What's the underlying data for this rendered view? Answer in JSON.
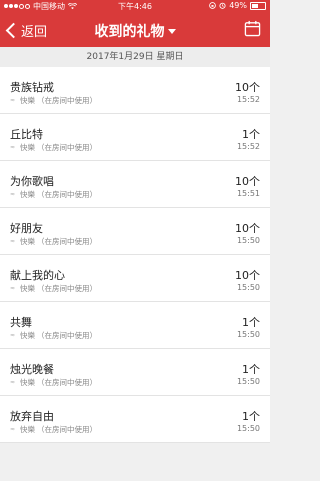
{
  "statusbar": {
    "carrier": "中国移动",
    "time": "下午4:46",
    "battery": "49%",
    "battery_level": 0.49
  },
  "nav": {
    "back_label": "返回",
    "title": "收到的礼物"
  },
  "date_header": "2017年1月29日 星期日",
  "gifts": [
    {
      "name": "贵族钻戒",
      "sender": "快樂",
      "note": "（在房间中使用）",
      "count": "10个",
      "time": "15:52"
    },
    {
      "name": "丘比特",
      "sender": "快樂",
      "note": "（在房间中使用）",
      "count": "1个",
      "time": "15:52"
    },
    {
      "name": "为你歌唱",
      "sender": "快樂",
      "note": "（在房间中使用）",
      "count": "10个",
      "time": "15:51"
    },
    {
      "name": "好朋友",
      "sender": "快樂",
      "note": "（在房间中使用）",
      "count": "10个",
      "time": "15:50"
    },
    {
      "name": "献上我的心",
      "sender": "快樂",
      "note": "（在房间中使用）",
      "count": "10个",
      "time": "15:50"
    },
    {
      "name": "共舞",
      "sender": "快樂",
      "note": "（在房间中使用）",
      "count": "1个",
      "time": "15:50"
    },
    {
      "name": "烛光晚餐",
      "sender": "快樂",
      "note": "（在房间中使用）",
      "count": "1个",
      "time": "15:50"
    },
    {
      "name": "放弃自由",
      "sender": "快樂",
      "note": "（在房间中使用）",
      "count": "1个",
      "time": "15:50"
    }
  ],
  "colors": {
    "accent": "#d93a3a",
    "background": "#f0f0f0"
  },
  "icons": [
    "signal-icon",
    "wifi-icon",
    "lock-rotation-icon",
    "alarm-icon",
    "battery-icon",
    "back-chevron-icon",
    "dropdown-caret-icon",
    "calendar-icon",
    "wing-icon"
  ]
}
